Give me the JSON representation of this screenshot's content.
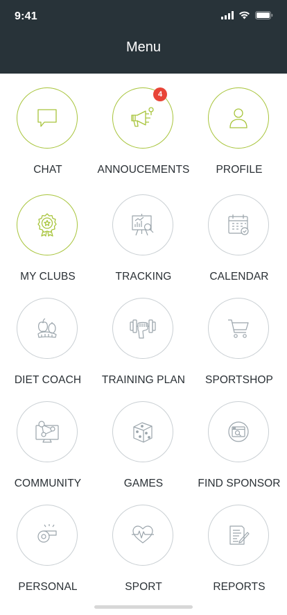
{
  "status_bar": {
    "time": "9:41"
  },
  "header": {
    "title": "Menu"
  },
  "menu": [
    {
      "label": "CHAT",
      "icon": "chat-icon"
    },
    {
      "label": "ANNOUCEMENTS",
      "icon": "megaphone-icon",
      "badge": "4"
    },
    {
      "label": "PROFILE",
      "icon": "user-icon"
    },
    {
      "label": "MY CLUBS",
      "icon": "medal-icon"
    },
    {
      "label": "TRACKING",
      "icon": "presentation-chart-icon"
    },
    {
      "label": "CALENDAR",
      "icon": "calendar-icon"
    },
    {
      "label": "DIET COACH",
      "icon": "fruits-icon"
    },
    {
      "label": "TRAINING PLAN",
      "icon": "dumbbell-icon"
    },
    {
      "label": "SPORTSHOP",
      "icon": "cart-icon"
    },
    {
      "label": "COMMUNITY",
      "icon": "network-monitor-icon"
    },
    {
      "label": "GAMES",
      "icon": "dice-icon"
    },
    {
      "label": "FIND SPONSOR",
      "icon": "web-search-icon"
    },
    {
      "label": "PERSONAL",
      "icon": "whistle-icon"
    },
    {
      "label": "SPORT",
      "icon": "heartbeat-icon"
    },
    {
      "label": "REPORTS",
      "icon": "report-icon"
    }
  ],
  "colors": {
    "header_bg": "#283339",
    "accent": "#a7c43a",
    "badge": "#e84437",
    "icon_gray": "#9aa4ab",
    "text": "#2a3035"
  }
}
